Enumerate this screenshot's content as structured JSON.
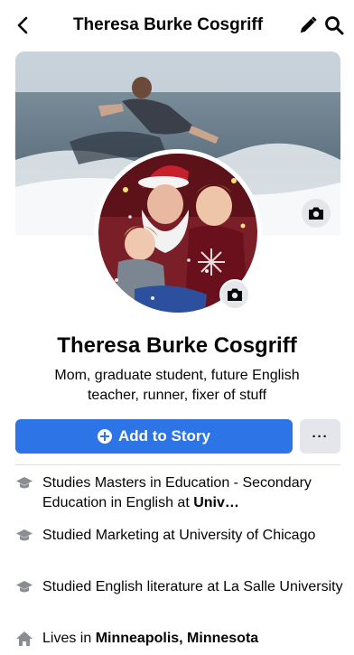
{
  "header": {
    "title": "Theresa Burke Cosgriff",
    "back_icon": "chevron-left-icon",
    "edit_icon": "pencil-icon",
    "search_icon": "search-icon"
  },
  "profile": {
    "name": "Theresa Burke Cosgriff",
    "bio": "Mom, graduate student, future English teacher, runner, fixer of stuff"
  },
  "actions": {
    "add_story_label": "Add to Story",
    "more_label": "···"
  },
  "details": [
    {
      "icon": "education-cap-icon",
      "prefix": "Studies Masters in Education - Secondary Education in English at ",
      "bold": "Univ…"
    },
    {
      "icon": "education-cap-icon",
      "prefix": "Studied Marketing at University of Chicago",
      "bold": ""
    },
    {
      "icon": "education-cap-icon",
      "prefix": "Studied English literature at La Salle University",
      "bold": ""
    },
    {
      "icon": "home-icon",
      "prefix": "Lives in ",
      "bold": "Minneapolis, Minnesota"
    }
  ],
  "colors": {
    "primary_button": "#2d74e7",
    "secondary_button": "#e4e6eb",
    "text": "#050505",
    "icon_gray": "#65676b"
  }
}
